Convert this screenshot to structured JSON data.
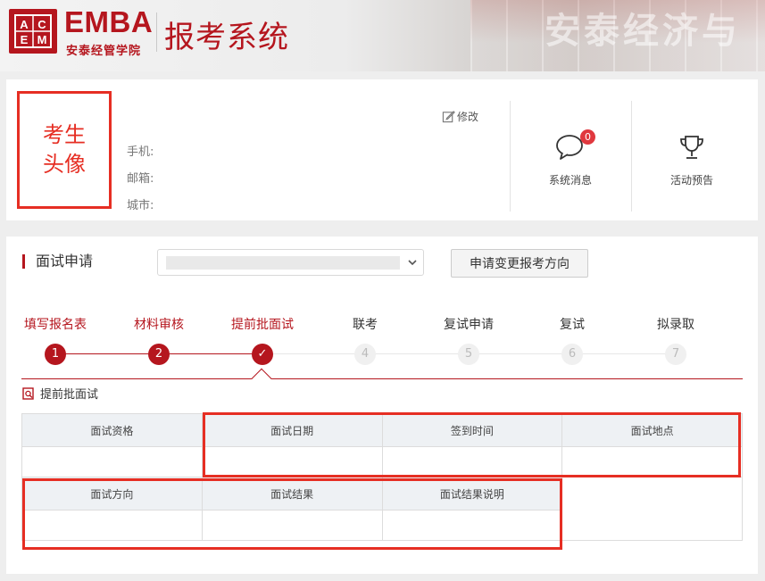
{
  "header": {
    "logo_mark": "ACEM",
    "logo_emba": "EMBA",
    "logo_sub": "安泰经管学院",
    "system_title": "报考系统",
    "background_text": "安泰经济与"
  },
  "profile": {
    "avatar_text": "考生头像",
    "phone_label": "手机:",
    "email_label": "邮箱:",
    "city_label": "城市:",
    "edit_label": "修改",
    "messages_label": "系统消息",
    "messages_count": "0",
    "events_label": "活动预告"
  },
  "application": {
    "section_title": "面试申请",
    "change_direction_button": "申请变更报考方向",
    "steps": [
      {
        "label": "填写报名表",
        "number": "1",
        "status": "done"
      },
      {
        "label": "材料审核",
        "number": "2",
        "status": "done"
      },
      {
        "label": "提前批面试",
        "number": "✓",
        "status": "current"
      },
      {
        "label": "联考",
        "number": "4",
        "status": "todo"
      },
      {
        "label": "复试申请",
        "number": "5",
        "status": "todo"
      },
      {
        "label": "复试",
        "number": "6",
        "status": "todo"
      },
      {
        "label": "拟录取",
        "number": "7",
        "status": "todo"
      }
    ],
    "panel_title": "提前批面试",
    "table_row1_headers": [
      "面试资格",
      "面试日期",
      "签到时间",
      "面试地点"
    ],
    "table_row2_headers": [
      "面试方向",
      "面试结果",
      "面试结果说明"
    ]
  },
  "colors": {
    "brand_red": "#b5161e",
    "highlight_red": "#e62e23",
    "badge_red": "#e0383e"
  }
}
